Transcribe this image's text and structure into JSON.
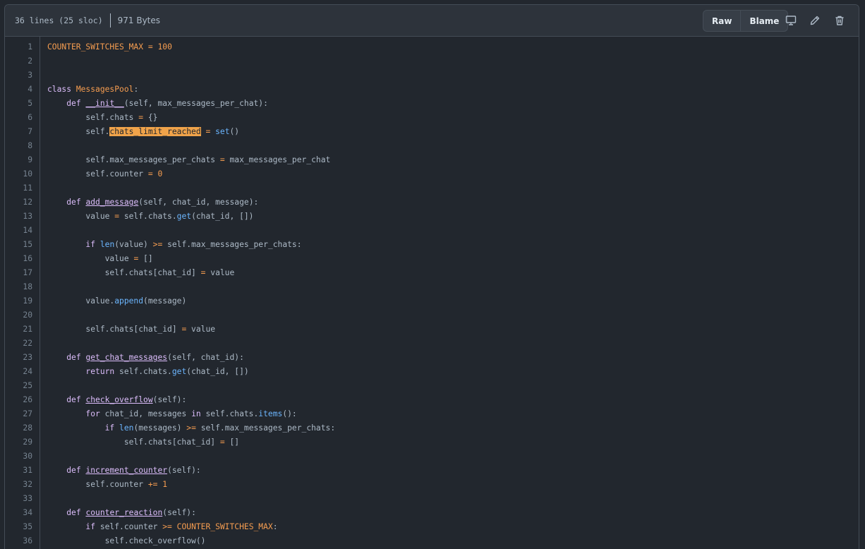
{
  "file_info": {
    "lines": "36 lines (25 sloc)",
    "size": "971 Bytes"
  },
  "toolbar": {
    "raw_label": "Raw",
    "blame_label": "Blame",
    "icons": [
      "desktop-icon",
      "pencil-icon",
      "trash-icon"
    ]
  },
  "code": {
    "language": "python",
    "highlighted_token": "chats_limit_reached",
    "line_numbers": [
      "1",
      "2",
      "3",
      "4",
      "5",
      "6",
      "7",
      "8",
      "9",
      "10",
      "11",
      "12",
      "13",
      "14",
      "15",
      "16",
      "17",
      "18",
      "19",
      "20",
      "21",
      "22",
      "23",
      "24",
      "25",
      "26",
      "27",
      "28",
      "29",
      "30",
      "31",
      "32",
      "33",
      "34",
      "35",
      "36"
    ],
    "lines": [
      "COUNTER_SWITCHES_MAX = 100",
      "",
      "",
      "class MessagesPool:",
      "    def __init__(self, max_messages_per_chat):",
      "        self.chats = {}",
      "        self.chats_limit_reached = set()",
      "",
      "        self.max_messages_per_chats = max_messages_per_chat",
      "        self.counter = 0",
      "",
      "    def add_message(self, chat_id, message):",
      "        value = self.chats.get(chat_id, [])",
      "",
      "        if len(value) >= self.max_messages_per_chats:",
      "            value = []",
      "            self.chats[chat_id] = value",
      "",
      "        value.append(message)",
      "",
      "        self.chats[chat_id] = value",
      "",
      "    def get_chat_messages(self, chat_id):",
      "        return self.chats.get(chat_id, [])",
      "",
      "    def check_overflow(self):",
      "        for chat_id, messages in self.chats.items():",
      "            if len(messages) >= self.max_messages_per_chats:",
      "                self.chats[chat_id] = []",
      "",
      "    def increment_counter(self):",
      "        self.counter += 1",
      "",
      "    def counter_reaction(self):",
      "        if self.counter >= COUNTER_SWITCHES_MAX:",
      "            self.check_overflow()"
    ]
  }
}
